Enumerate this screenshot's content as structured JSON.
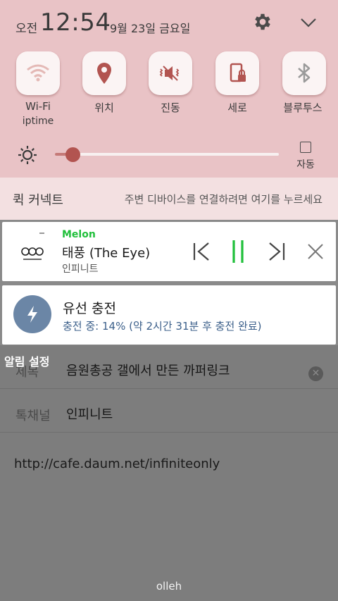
{
  "status": {
    "ampm": "오전",
    "time": "12:54",
    "date": "9월 23일 금요일"
  },
  "quick_settings": [
    {
      "label": "Wi-Fi",
      "sublabel": "iptime",
      "icon": "wifi-icon"
    },
    {
      "label": "위치",
      "icon": "location-icon"
    },
    {
      "label": "진동",
      "icon": "vibrate-icon"
    },
    {
      "label": "세로",
      "icon": "rotation-lock-icon"
    },
    {
      "label": "블루투스",
      "icon": "bluetooth-icon"
    }
  ],
  "brightness": {
    "level_percent": 8,
    "auto_label": "자동"
  },
  "quick_connect": {
    "title": "퀵 커넥트",
    "hint": "주변 디바이스를 연결하려면 여기를 누르세요"
  },
  "music": {
    "app": "Melon",
    "song": "태풍 (The Eye)",
    "artist": "인피니트"
  },
  "charging": {
    "title": "유선 충전",
    "status": "충전 중: 14% (약 2시간 31분 후 충전 완료)"
  },
  "background": {
    "alarm_label": "알림 설정",
    "subject_label": "제목",
    "subject_value": "음원총공 갤에서 만든 까퍼링크",
    "channel_label": "톡채널",
    "channel_value": "인피니트",
    "url": "http://cafe.daum.net/infiniteonly",
    "carrier": "olleh"
  },
  "colors": {
    "shade": "#e9c3c6",
    "accent": "#b25450",
    "melon_green": "#1fbf3a",
    "charge_blue": "#6b86a6"
  }
}
